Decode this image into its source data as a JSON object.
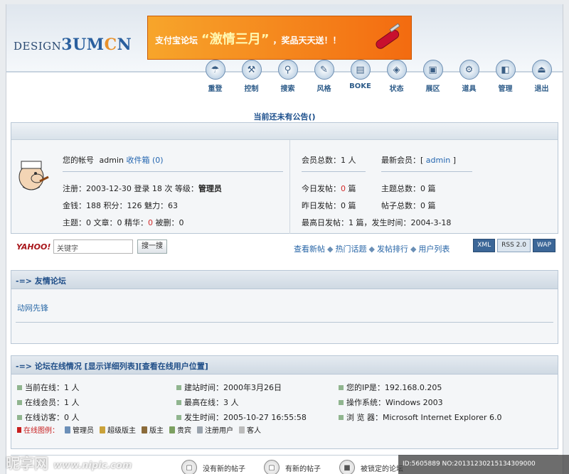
{
  "header": {
    "logo_prefix": "DESIGN",
    "logo_main": "3UM",
    "logo_o": "C",
    "logo_end": "N",
    "banner_text_a": "支付宝论坛",
    "banner_text_b": "“激情三月”",
    "banner_text_c": "，奖品天天送！！"
  },
  "nav": [
    {
      "label": "重登",
      "icon": "login-icon",
      "glyph": "☂"
    },
    {
      "label": "控制",
      "icon": "wrench-icon",
      "glyph": "⚒"
    },
    {
      "label": "搜索",
      "icon": "search-icon",
      "glyph": "⚲"
    },
    {
      "label": "风格",
      "icon": "brush-icon",
      "glyph": "✎"
    },
    {
      "label": "BOKE",
      "icon": "book-icon",
      "glyph": "▤"
    },
    {
      "label": "状态",
      "icon": "cube-icon",
      "glyph": "◈"
    },
    {
      "label": "展区",
      "icon": "box-icon",
      "glyph": "▣"
    },
    {
      "label": "道具",
      "icon": "tool-icon",
      "glyph": "⚙"
    },
    {
      "label": "管理",
      "icon": "folder-icon",
      "glyph": "◧"
    },
    {
      "label": "退出",
      "icon": "exit-icon",
      "glyph": "⏏"
    }
  ],
  "notice": "当前还未有公告()",
  "user": {
    "account_label": "您的帐号",
    "account_name": "admin",
    "inbox_label": "收件箱",
    "inbox_count": "(0)",
    "line1a": "注册：2003-12-30 登录 18 次 等级：",
    "line1b": "管理员",
    "line2": "金钱：188 积分：126 魅力：63",
    "line3a": "主题：0 文章：0 精华：",
    "line3b": "0",
    "line3c": " 被删：0"
  },
  "stats": {
    "members_total": "会员总数：1 人",
    "newest_label": "最新会员：[",
    "newest_name": "admin",
    "newest_end": "]",
    "today_a": "今日发帖：",
    "today_b": "0",
    "today_c": " 篇",
    "topics_total": "主题总数：0 篇",
    "yesterday": "昨日发帖：0 篇",
    "posts_total": "帖子总数：0 篇",
    "max_day": "最高日发帖：1 篇，发生时间：2004-3-18"
  },
  "search": {
    "brand": "YAHOO!",
    "placeholder": "关键字",
    "button": "搜一搜"
  },
  "quicklinks": [
    "查看新帖",
    "热门话题",
    "发帖排行",
    "用户列表"
  ],
  "feeds": [
    "XML",
    "RSS 2.0",
    "WAP"
  ],
  "friends": {
    "title": "-=> 友情论坛",
    "item": "动网先锋"
  },
  "online": {
    "title_prefix": "-=> 论坛在线情况 ",
    "link1": "[显示详细列表]",
    "link2": "[查看在线用户位置]",
    "cells": [
      [
        "当前在线：1 人",
        "建站时间：2000年3月26日",
        "您的IP是：192.168.0.205"
      ],
      [
        "在线会员：1 人",
        "最高在线：3 人",
        "操作系统：Windows 2003"
      ],
      [
        "在线访客：0 人",
        "发生时间：2005-10-27 16:55:58",
        "浏 览 器：Microsoft Internet Explorer 6.0"
      ]
    ],
    "legend_title": "在线图例：",
    "legend": [
      "管理员",
      "超级版主",
      "版主",
      "贵宾",
      "注册用户",
      "客人"
    ]
  },
  "footer_items": [
    "没有新的帖子",
    "有新的帖子",
    "被锁定的论坛"
  ],
  "watermark": {
    "left": "昵享网",
    "left_url": "www.nipic.com",
    "right": "ID:5605889 NO:20131230215134309000"
  }
}
